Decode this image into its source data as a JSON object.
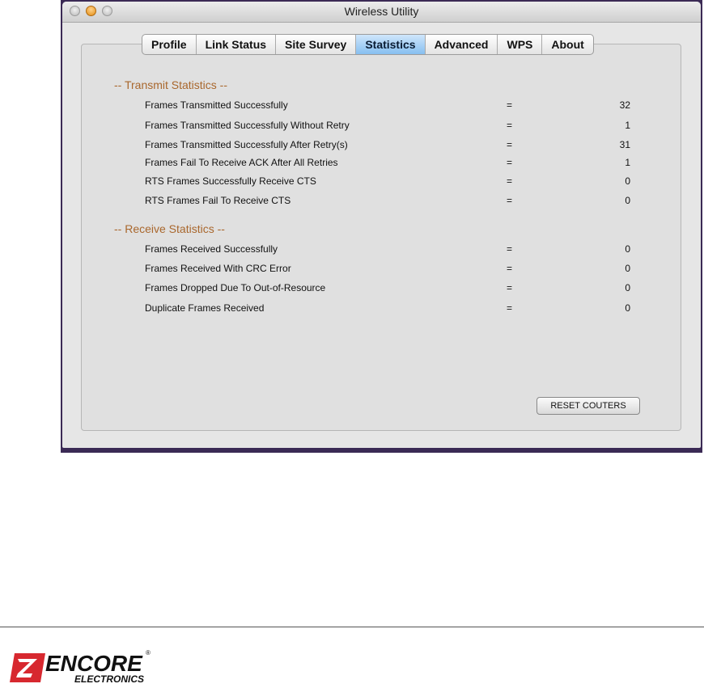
{
  "window": {
    "title": "Wireless Utility"
  },
  "tabs": [
    {
      "label": "Profile",
      "active": false
    },
    {
      "label": "Link Status",
      "active": false
    },
    {
      "label": "Site Survey",
      "active": false
    },
    {
      "label": "Statistics",
      "active": true
    },
    {
      "label": "Advanced",
      "active": false
    },
    {
      "label": "WPS",
      "active": false
    },
    {
      "label": "About",
      "active": false
    }
  ],
  "transmit": {
    "title": "-- Transmit Statistics --",
    "rows": [
      {
        "label": "Frames Transmitted Successfully",
        "eq": "=",
        "value": "32"
      },
      {
        "label": "Frames Transmitted Successfully Without Retry",
        "eq": "=",
        "value": "1"
      },
      {
        "label": "Frames Transmitted Successfully After Retry(s)",
        "eq": "=",
        "value": "31"
      },
      {
        "label": "Frames Fail To Receive ACK After All Retries",
        "eq": "=",
        "value": "1"
      },
      {
        "label": "RTS Frames Successfully Receive CTS",
        "eq": "=",
        "value": "0"
      },
      {
        "label": "RTS Frames Fail To Receive CTS",
        "eq": "=",
        "value": "0"
      }
    ]
  },
  "receive": {
    "title": "-- Receive Statistics --",
    "rows": [
      {
        "label": "Frames Received Successfully",
        "eq": "=",
        "value": "0"
      },
      {
        "label": "Frames Received With CRC Error",
        "eq": "=",
        "value": "0"
      },
      {
        "label": "Frames Dropped Due To Out-of-Resource",
        "eq": "=",
        "value": "0"
      },
      {
        "label": "Duplicate Frames Received",
        "eq": "=",
        "value": "0"
      }
    ]
  },
  "buttons": {
    "reset": "RESET COUTERS"
  },
  "footer": {
    "logo_main": "ENCORE",
    "logo_sub": "ELECTRONICS",
    "logo_mark": "®",
    "brand_color": "#d7282f"
  }
}
